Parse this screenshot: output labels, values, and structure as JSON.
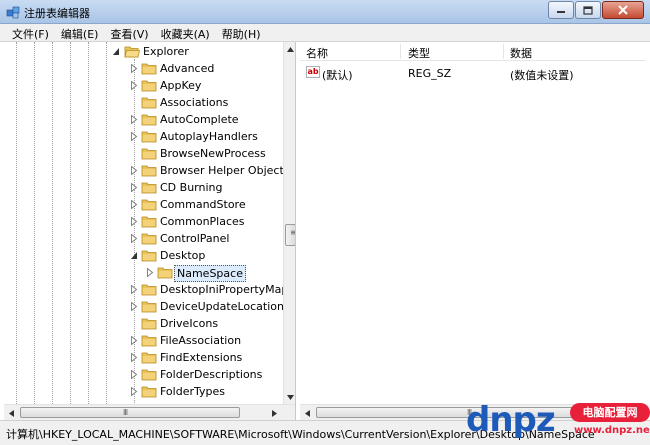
{
  "window": {
    "title": "注册表编辑器",
    "icons": {
      "app": "registry-editor-icon",
      "minimize": "minimize-icon",
      "maximize": "maximize-icon",
      "close": "close-icon"
    }
  },
  "menu": [
    {
      "label": "文件(F)"
    },
    {
      "label": "编辑(E)"
    },
    {
      "label": "查看(V)"
    },
    {
      "label": "收藏夹(A)"
    },
    {
      "label": "帮助(H)"
    }
  ],
  "tree": {
    "parent": {
      "label": "Explorer",
      "expanded": true
    },
    "items": [
      {
        "label": "Advanced",
        "expander": "collapsed"
      },
      {
        "label": "AppKey",
        "expander": "collapsed"
      },
      {
        "label": "Associations",
        "expander": "none"
      },
      {
        "label": "AutoComplete",
        "expander": "collapsed"
      },
      {
        "label": "AutoplayHandlers",
        "expander": "collapsed"
      },
      {
        "label": "BrowseNewProcess",
        "expander": "none"
      },
      {
        "label": "Browser Helper Objects",
        "expander": "collapsed"
      },
      {
        "label": "CD Burning",
        "expander": "collapsed"
      },
      {
        "label": "CommandStore",
        "expander": "collapsed"
      },
      {
        "label": "CommonPlaces",
        "expander": "collapsed"
      },
      {
        "label": "ControlPanel",
        "expander": "collapsed"
      },
      {
        "label": "Desktop",
        "expander": "expanded"
      },
      {
        "label": "NameSpace",
        "expander": "collapsed",
        "child": true,
        "selected": true
      },
      {
        "label": "DesktopIniPropertyMap",
        "expander": "collapsed"
      },
      {
        "label": "DeviceUpdateLocations",
        "expander": "collapsed"
      },
      {
        "label": "DriveIcons",
        "expander": "none"
      },
      {
        "label": "FileAssociation",
        "expander": "collapsed"
      },
      {
        "label": "FindExtensions",
        "expander": "collapsed"
      },
      {
        "label": "FolderDescriptions",
        "expander": "collapsed"
      },
      {
        "label": "FolderTypes",
        "expander": "collapsed"
      }
    ]
  },
  "list": {
    "columns": {
      "name": "名称",
      "type": "类型",
      "data": "数据"
    },
    "rows": [
      {
        "icon": "string-value-icon",
        "icon_text": "ab",
        "name": "(默认)",
        "type": "REG_SZ",
        "data": "(数值未设置)"
      }
    ]
  },
  "scrollbar": {
    "grip": "III"
  },
  "status": {
    "path": "计算机\\HKEY_LOCAL_MACHINE\\SOFTWARE\\Microsoft\\Windows\\CurrentVersion\\Explorer\\Desktop\\NameSpace"
  },
  "watermark": {
    "logo": "dnpz",
    "badge": "电脑配置网",
    "url": "www.dnpz.net"
  },
  "colors": {
    "folder": "#e8c35a",
    "selection": "#dcecfc",
    "watermark_blue": "#1e5bb8",
    "watermark_red": "#e8203a"
  }
}
